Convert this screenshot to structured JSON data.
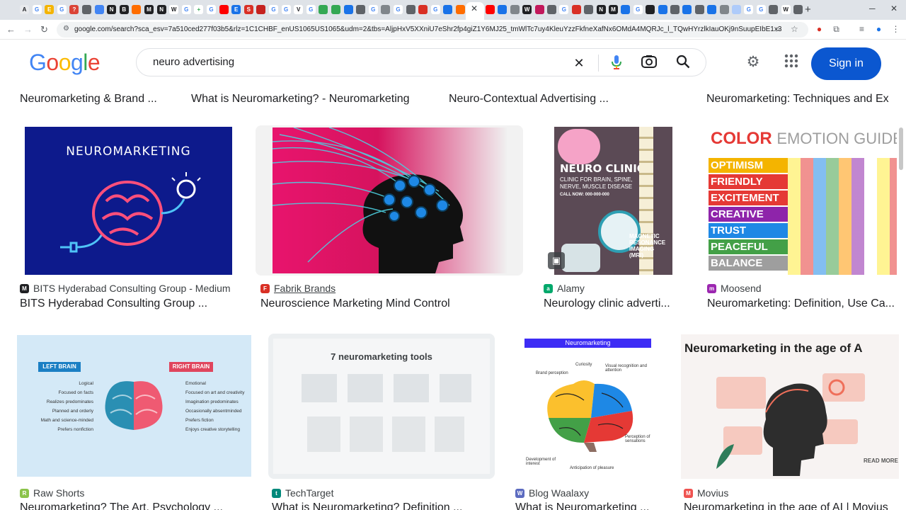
{
  "browser": {
    "tab_favicons": [
      {
        "char": "A",
        "color": "#e8eaed",
        "fg": "#202124"
      },
      {
        "char": "G",
        "color": "#ffffff",
        "fg": "#4285f4"
      },
      {
        "char": "E",
        "color": "#f4b400",
        "fg": "#ffffff"
      },
      {
        "char": "G",
        "color": "#ffffff",
        "fg": "#4285f4"
      },
      {
        "char": "?",
        "color": "#db4437",
        "fg": "#ffffff"
      },
      {
        "char": "",
        "color": "#5f6368",
        "fg": "#ffffff"
      },
      {
        "char": "",
        "color": "#4285f4",
        "fg": "#ffffff"
      },
      {
        "char": "N",
        "color": "#202124",
        "fg": "#ffffff"
      },
      {
        "char": "B",
        "color": "#202124",
        "fg": "#ffffff"
      },
      {
        "char": "",
        "color": "#ff6d00",
        "fg": "#ffffff"
      },
      {
        "char": "M",
        "color": "#202124",
        "fg": "#ffffff"
      },
      {
        "char": "N",
        "color": "#202124",
        "fg": "#ffffff"
      },
      {
        "char": "W",
        "color": "#ffffff",
        "fg": "#202124"
      },
      {
        "char": "G",
        "color": "#ffffff",
        "fg": "#4285f4"
      },
      {
        "char": "+",
        "color": "#ffffff",
        "fg": "#34a853"
      },
      {
        "char": "G",
        "color": "#ffffff",
        "fg": "#4285f4"
      },
      {
        "char": "",
        "color": "#ff0000",
        "fg": "#ffffff"
      },
      {
        "char": "E",
        "color": "#1a73e8",
        "fg": "#ffffff"
      },
      {
        "char": "S",
        "color": "#d93025",
        "fg": "#ffffff"
      },
      {
        "char": "",
        "color": "#c5221f",
        "fg": "#ffffff"
      },
      {
        "char": "G",
        "color": "#ffffff",
        "fg": "#4285f4"
      },
      {
        "char": "G",
        "color": "#ffffff",
        "fg": "#4285f4"
      },
      {
        "char": "V",
        "color": "#ffffff",
        "fg": "#202124"
      },
      {
        "char": "G",
        "color": "#ffffff",
        "fg": "#4285f4"
      },
      {
        "char": "",
        "color": "#34a853",
        "fg": "#ffffff"
      },
      {
        "char": "",
        "color": "#34a853",
        "fg": "#ffffff"
      },
      {
        "char": "",
        "color": "#1a73e8",
        "fg": "#ffffff"
      },
      {
        "char": "",
        "color": "#5f6368",
        "fg": "#ffffff"
      },
      {
        "char": "G",
        "color": "#ffffff",
        "fg": "#4285f4"
      },
      {
        "char": "",
        "color": "#80868b",
        "fg": "#ffffff"
      },
      {
        "char": "G",
        "color": "#ffffff",
        "fg": "#4285f4"
      },
      {
        "char": "",
        "color": "#5f6368",
        "fg": "#ffffff"
      },
      {
        "char": "",
        "color": "#d93025",
        "fg": "#ffffff"
      },
      {
        "char": "G",
        "color": "#ffffff",
        "fg": "#4285f4"
      },
      {
        "char": "",
        "color": "#1a73e8",
        "fg": "#ffffff"
      },
      {
        "char": "",
        "color": "#ff6d00",
        "fg": "#ffffff"
      }
    ],
    "tab_favicons_right": [
      {
        "char": "",
        "color": "#ff0000",
        "fg": "#ffffff"
      },
      {
        "char": "",
        "color": "#1a73e8",
        "fg": "#ffffff"
      },
      {
        "char": "",
        "color": "#80868b",
        "fg": "#ffffff"
      },
      {
        "char": "W",
        "color": "#202124",
        "fg": "#ffffff"
      },
      {
        "char": "",
        "color": "#c2185b",
        "fg": "#ffffff"
      },
      {
        "char": "",
        "color": "#5f6368",
        "fg": "#ffffff"
      },
      {
        "char": "G",
        "color": "#ffffff",
        "fg": "#4285f4"
      },
      {
        "char": "",
        "color": "#d93025",
        "fg": "#ffffff"
      },
      {
        "char": "",
        "color": "#5f6368",
        "fg": "#ffffff"
      },
      {
        "char": "N",
        "color": "#202124",
        "fg": "#ffffff"
      },
      {
        "char": "M",
        "color": "#202124",
        "fg": "#ffffff"
      },
      {
        "char": "",
        "color": "#1a73e8",
        "fg": "#ffffff"
      },
      {
        "char": "G",
        "color": "#ffffff",
        "fg": "#4285f4"
      },
      {
        "char": "",
        "color": "#202124",
        "fg": "#ffffff"
      },
      {
        "char": "",
        "color": "#1a73e8",
        "fg": "#ffffff"
      },
      {
        "char": "",
        "color": "#5f6368",
        "fg": "#ffffff"
      },
      {
        "char": "",
        "color": "#1a73e8",
        "fg": "#ffffff"
      },
      {
        "char": "",
        "color": "#5f6368",
        "fg": "#ffffff"
      },
      {
        "char": "",
        "color": "#1a73e8",
        "fg": "#ffffff"
      },
      {
        "char": "",
        "color": "#80868b",
        "fg": "#ffffff"
      },
      {
        "char": "",
        "color": "#aecbfa",
        "fg": "#ffffff"
      },
      {
        "char": "G",
        "color": "#ffffff",
        "fg": "#4285f4"
      },
      {
        "char": "G",
        "color": "#ffffff",
        "fg": "#4285f4"
      },
      {
        "char": "",
        "color": "#5f6368",
        "fg": "#ffffff"
      },
      {
        "char": "W",
        "color": "#ffffff",
        "fg": "#202124"
      },
      {
        "char": "",
        "color": "#5f6368",
        "fg": "#ffffff"
      }
    ],
    "url": "google.com/search?sca_esv=7a510ced277f03b5&rlz=1C1CHBF_enUS1065US1065&udm=2&tbs=AljpHxV5XXniU7eShr2fp4giZ1Y6MJ25_tmWlTc7uy4KleuYzzFkfneXafNx6OMdA4MQRJc_l_TQwHYrzlkIauOKj9nSuupEIbE1x32lFLEvPT3Jm08..."
  },
  "header": {
    "logo_letters": [
      {
        "ch": "G",
        "color": "#4285f4"
      },
      {
        "ch": "o",
        "color": "#ea4335"
      },
      {
        "ch": "o",
        "color": "#fbbc05"
      },
      {
        "ch": "g",
        "color": "#4285f4"
      },
      {
        "ch": "l",
        "color": "#34a853"
      },
      {
        "ch": "e",
        "color": "#ea4335"
      }
    ],
    "query": "neuro advertising",
    "sign_in": "Sign in"
  },
  "results": {
    "top_titles": [
      "Neuromarketing & Brand ...",
      "What is Neuromarketing? - Neuromarketing",
      "Neuro-Contextual Advertising ...",
      "Neuromarketing: Techniques and Ex"
    ],
    "row1": [
      {
        "source": "BITS Hyderabad Consulting Group - Medium",
        "fav_char": "M",
        "fav_color": "#202124",
        "title": "BITS Hyderabad Consulting Group ..."
      },
      {
        "source": "Fabrik Brands",
        "fav_char": "F",
        "fav_color": "#d93025",
        "title": "Neuroscience Marketing Mind Control"
      },
      {
        "source": "Alamy",
        "fav_char": "a",
        "fav_color": "#00a86b",
        "title": "Neurology clinic adverti..."
      },
      {
        "source": "Moosend",
        "fav_char": "m",
        "fav_color": "#9c27b0",
        "title": "Neuromarketing: Definition, Use Ca..."
      }
    ],
    "row2": [
      {
        "source": "Raw Shorts",
        "fav_char": "R",
        "fav_color": "#8bc34a",
        "title": "Neuromarketing? The Art, Psychology ..."
      },
      {
        "source": "TechTarget",
        "fav_char": "t",
        "fav_color": "#00897b",
        "title": "What is Neuromarketing? Definition ..."
      },
      {
        "source": "Blog Waalaxy",
        "fav_char": "W",
        "fav_color": "#5c6bc0",
        "title": "What is Neuromarketing ..."
      },
      {
        "source": "Movius",
        "fav_char": "M",
        "fav_color": "#ef5350",
        "title": "Neuromarketing in the age of AI | Movius"
      }
    ],
    "image_text": {
      "neuromarketing_banner": "NEUROMARKETING",
      "clinic_title": "NEURO CLINIC",
      "clinic_sub1": "CLINIC FOR BRAIN, SPINE,",
      "clinic_sub2": "NERVE, MUSCLE DISEASE",
      "clinic_call": "CALL NOW: 000-000-000",
      "clinic_mri1": "MAGNETIC",
      "clinic_mri2": "RESONANCE",
      "clinic_mri3": "IMAGING",
      "clinic_mri4": "(MRI)",
      "color_guide_1": "COLOR",
      "color_guide_2": "EMOTION GUIDE",
      "emotions": [
        "OPTIMISM",
        "FRIENDLY",
        "EXCITEMENT",
        "CREATIVE",
        "TRUST",
        "PEACEFUL",
        "BALANCE"
      ],
      "left_brain": "LEFT BRAIN",
      "right_brain": "RIGHT BRAIN",
      "left_traits": [
        "Logical",
        "Focused on facts",
        "Realizes predominates",
        "Planned and orderly",
        "Math and science-minded",
        "Prefers nonfiction"
      ],
      "right_traits": [
        "Emotional",
        "Focused on art and creativity",
        "Imagination predominates",
        "Occasionally absentminded",
        "Prefers fiction",
        "Enjoys creative storytelling"
      ],
      "tools_title": "7 neuromarketing tools",
      "waalaxy_banner": "Neuromarketing",
      "waalaxy_labels": [
        "Curiosity",
        "Brand perception",
        "Visual recognition and attention",
        "Perception of sensations",
        "Development of interest",
        "Anticipation of pleasure"
      ],
      "movius_title": "Neuromarketing in the age of A",
      "read_more": "READ MORE"
    }
  }
}
